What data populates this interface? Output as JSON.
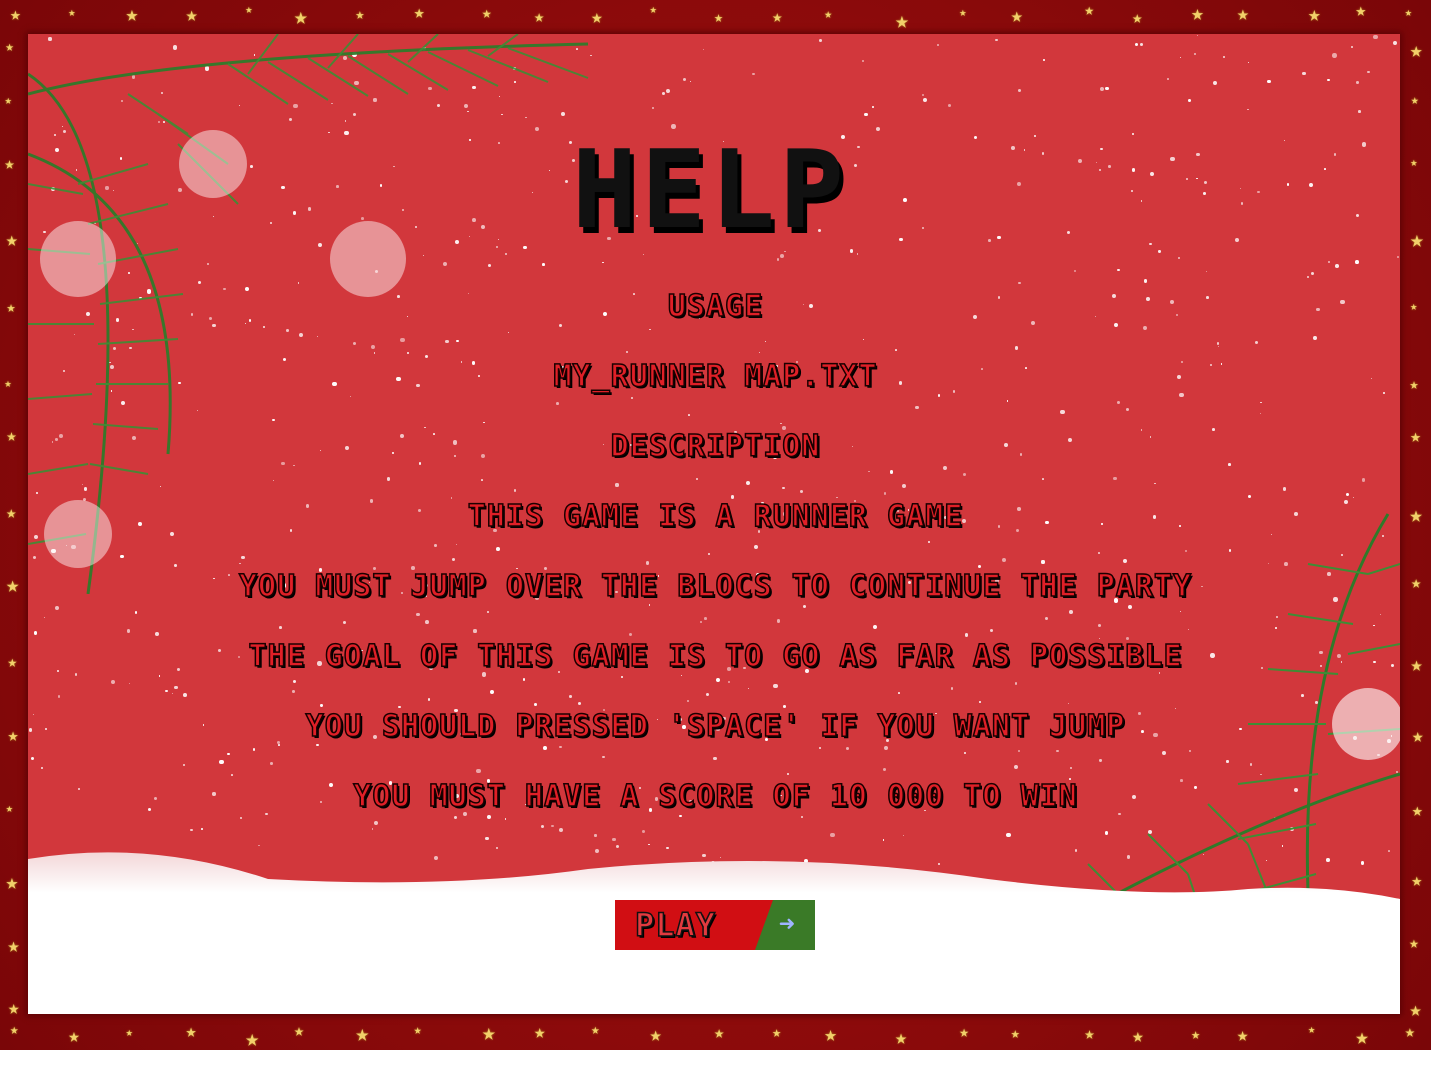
{
  "title": "HELP",
  "sections": [
    "USAGE",
    "MY_RUNNER MAP.TXT",
    "DESCRIPTION",
    "THIS GAME IS A RUNNER GAME",
    "YOU MUST JUMP OVER THE BLOCS TO CONTINUE THE PARTY",
    "THE GOAL OF THIS GAME IS TO GO AS FAR AS POSSIBLE",
    "YOU SHOULD PRESSED 'SPACE' IF YOU WANT JUMP",
    "YOU MUST HAVE A SCORE OF 10 000 TO WIN"
  ],
  "play_button": {
    "label": "PLAY",
    "icon": "enter-arrow-icon"
  },
  "colors": {
    "panel": "#d2373c",
    "frame": "#8e0a0c",
    "text": "#e01f27",
    "play_red": "#d10e13",
    "play_green": "#3a7a27"
  }
}
